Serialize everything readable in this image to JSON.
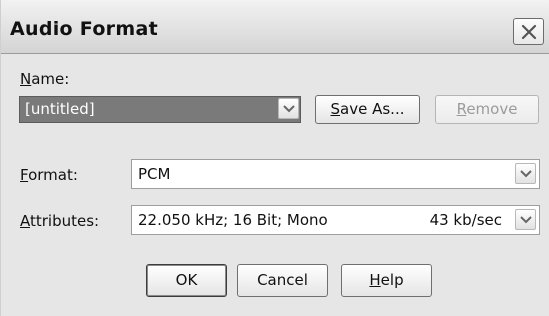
{
  "window": {
    "title": "Audio Format"
  },
  "name_section": {
    "label_accel": "N",
    "label_rest": "ame:",
    "selected_value": "[untitled]"
  },
  "buttons": {
    "save_as_accel": "S",
    "save_as_rest": "ave As...",
    "remove_accel": "R",
    "remove_rest": "emove",
    "ok": "OK",
    "cancel": "Cancel",
    "help_accel": "H",
    "help_rest": "elp"
  },
  "format": {
    "label_accel": "F",
    "label_rest": "ormat:",
    "value": "PCM"
  },
  "attributes": {
    "label_accel": "A",
    "label_rest": "ttributes:",
    "value": "22.050 kHz; 16 Bit; Mono",
    "rate": "43 kb/sec"
  },
  "icons": {
    "close": "close-icon",
    "dropdown": "chevron-down-icon"
  }
}
